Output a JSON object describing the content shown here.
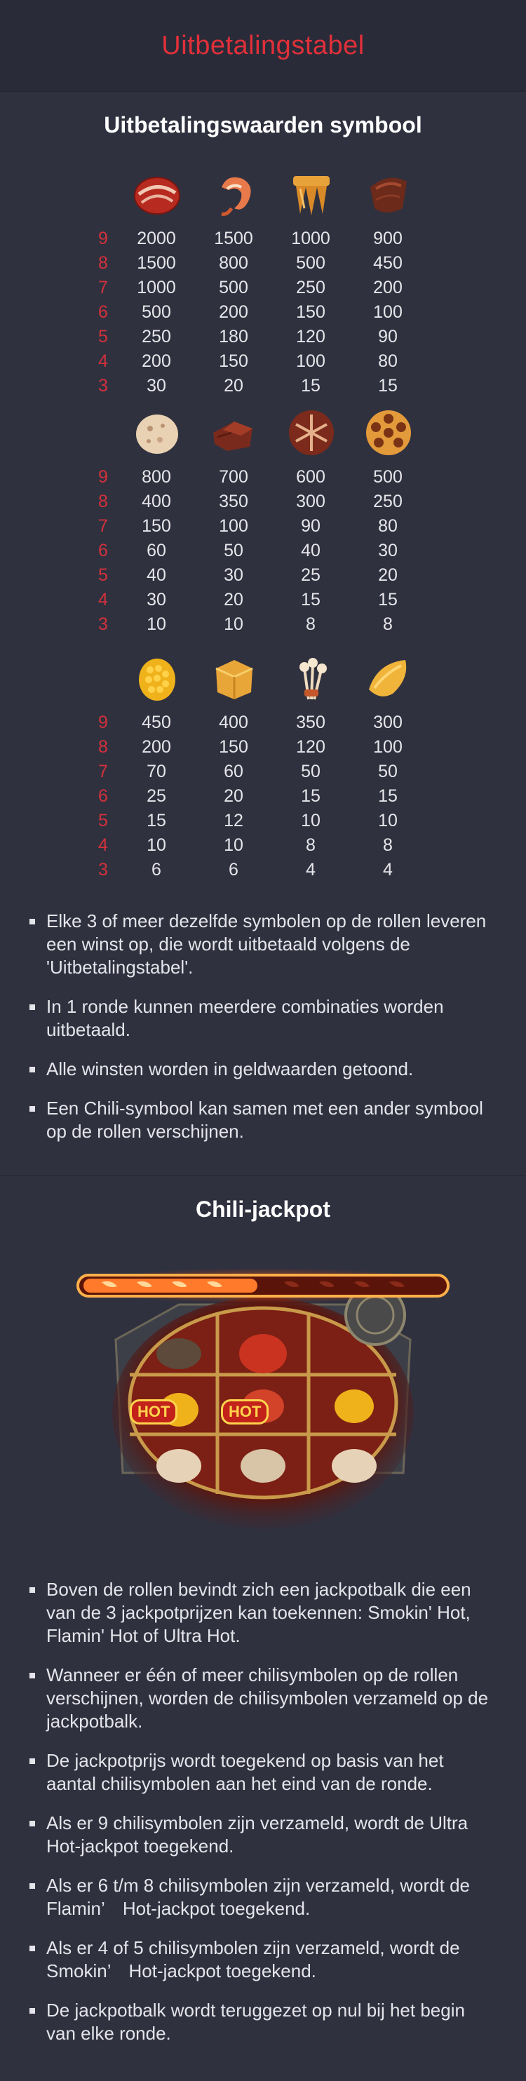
{
  "header": {
    "title": "Uitbetalingstabel"
  },
  "paytable": {
    "title": "Uitbetalingswaarden symbool",
    "counts": [
      "9",
      "8",
      "7",
      "6",
      "5",
      "4",
      "3"
    ],
    "groups": [
      {
        "icons": [
          "meat-slice-icon",
          "shrimp-icon",
          "tofu-skin-icon",
          "beef-slice-icon"
        ],
        "rows": [
          [
            "2000",
            "1500",
            "1000",
            "900"
          ],
          [
            "1500",
            "800",
            "500",
            "450"
          ],
          [
            "1000",
            "500",
            "250",
            "200"
          ],
          [
            "500",
            "200",
            "150",
            "100"
          ],
          [
            "250",
            "180",
            "120",
            "90"
          ],
          [
            "200",
            "150",
            "100",
            "80"
          ],
          [
            "30",
            "20",
            "15",
            "15"
          ]
        ]
      },
      {
        "icons": [
          "meatball-icon",
          "beef-chunk-icon",
          "mushroom-icon",
          "lotus-root-icon"
        ],
        "rows": [
          [
            "800",
            "700",
            "600",
            "500"
          ],
          [
            "400",
            "350",
            "300",
            "250"
          ],
          [
            "150",
            "100",
            "90",
            "80"
          ],
          [
            "60",
            "50",
            "40",
            "30"
          ],
          [
            "40",
            "30",
            "25",
            "20"
          ],
          [
            "30",
            "20",
            "15",
            "15"
          ],
          [
            "10",
            "10",
            "8",
            "8"
          ]
        ]
      },
      {
        "icons": [
          "corn-icon",
          "fried-tofu-icon",
          "enoki-mushroom-icon",
          "potato-icon"
        ],
        "rows": [
          [
            "450",
            "400",
            "350",
            "300"
          ],
          [
            "200",
            "150",
            "120",
            "100"
          ],
          [
            "70",
            "60",
            "50",
            "50"
          ],
          [
            "25",
            "20",
            "15",
            "15"
          ],
          [
            "15",
            "12",
            "10",
            "10"
          ],
          [
            "10",
            "10",
            "8",
            "8"
          ],
          [
            "6",
            "6",
            "4",
            "4"
          ]
        ]
      }
    ]
  },
  "rules": [
    "Elke 3 of meer dezelfde symbolen op de rollen leveren een winst op, die wordt uitbetaald volgens de 'Uitbetalingstabel'.",
    "In 1 ronde kunnen meerdere combinaties worden uitbetaald.",
    "Alle winsten worden in geldwaarden getoond.",
    "Een Chili-symbool kan samen met een ander symbool op de rollen verschijnen."
  ],
  "jackpot": {
    "title": "Chili-jackpot",
    "hot_label": "HOT",
    "bullets": [
      "Boven de rollen bevindt zich een jackpotbalk die een van de 3 jackpotprijzen kan toekennen: Smokin' Hot, Flamin' Hot of Ultra Hot.",
      "Wanneer er één of meer chilisymbolen op de rollen verschijnen, worden de chilisymbolen verzameld op de jackpotbalk.",
      "De jackpotprijs wordt toegekend op basis van het aantal chilisymbolen aan het eind van de ronde.",
      "Als er 9 chilisymbolen zijn verzameld, wordt de Ultra Hot-jackpot toegekend.",
      "Als er 6 t/m 8 chilisymbolen zijn verzameld, wordt de Flamin’　Hot-jackpot toegekend.",
      "Als er 4 of 5 chilisymbolen zijn verzameld, wordt de Smokin’　Hot-jackpot toegekend.",
      "De jackpotbalk wordt teruggezet op nul bij het begin van elke ronde."
    ]
  },
  "colors": {
    "accent": "#e1303a",
    "background": "#30313f",
    "header_bg": "#2a2b38"
  }
}
